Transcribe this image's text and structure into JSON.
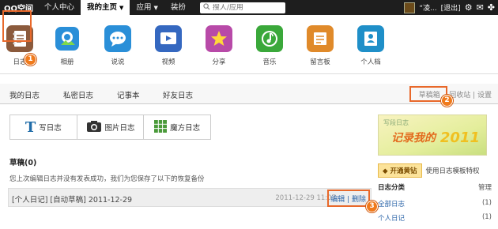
{
  "topbar": {
    "logo": "QQ空间",
    "nav": [
      "个人中心",
      "我的主页",
      "应用",
      "装扮"
    ],
    "search_placeholder": "搜人/应用",
    "user": "“凌...",
    "logout": "[退出]"
  },
  "apps": [
    {
      "label": "日志",
      "color": "#8b5a3c"
    },
    {
      "label": "相册",
      "color": "#2a8fd8"
    },
    {
      "label": "说说",
      "color": "#2a8fd8"
    },
    {
      "label": "视频",
      "color": "#3568c0"
    },
    {
      "label": "分享",
      "color": "#b84aa8"
    },
    {
      "label": "音乐",
      "color": "#3aa83a"
    },
    {
      "label": "留言板",
      "color": "#e08a2a"
    },
    {
      "label": "个人档",
      "color": "#1f8fc8"
    }
  ],
  "badges": [
    "1",
    "2",
    "3"
  ],
  "tabs": [
    "我的日志",
    "私密日志",
    "记事本",
    "好友日志"
  ],
  "tabs_right": {
    "draft": "草稿箱",
    "recycle": "回收站",
    "settings": "设置"
  },
  "types": [
    "写日志",
    "图片日志",
    "魔方日志"
  ],
  "drafts": {
    "title": "草稿(0)",
    "note": "您上次编辑日志并没有发表成功，我们为您保存了以下的恢复备份",
    "row_title": "[个人日记] [自动草稿]  2011-12-29",
    "row_time": "2011-12-29 11:07",
    "edit": "编辑",
    "delete": "删除"
  },
  "sidebar": {
    "banner_small": "写段日志",
    "banner_big": "记录我的",
    "banner_year": "2011",
    "vip_button": "开通黄钻",
    "vip_text": "使用日志模板特权",
    "cat_title": "日志分类",
    "cat_manage": "管理",
    "categories": [
      {
        "name": "全部日志",
        "count": "(1)"
      },
      {
        "name": "个人日记",
        "count": "(1)"
      }
    ]
  }
}
